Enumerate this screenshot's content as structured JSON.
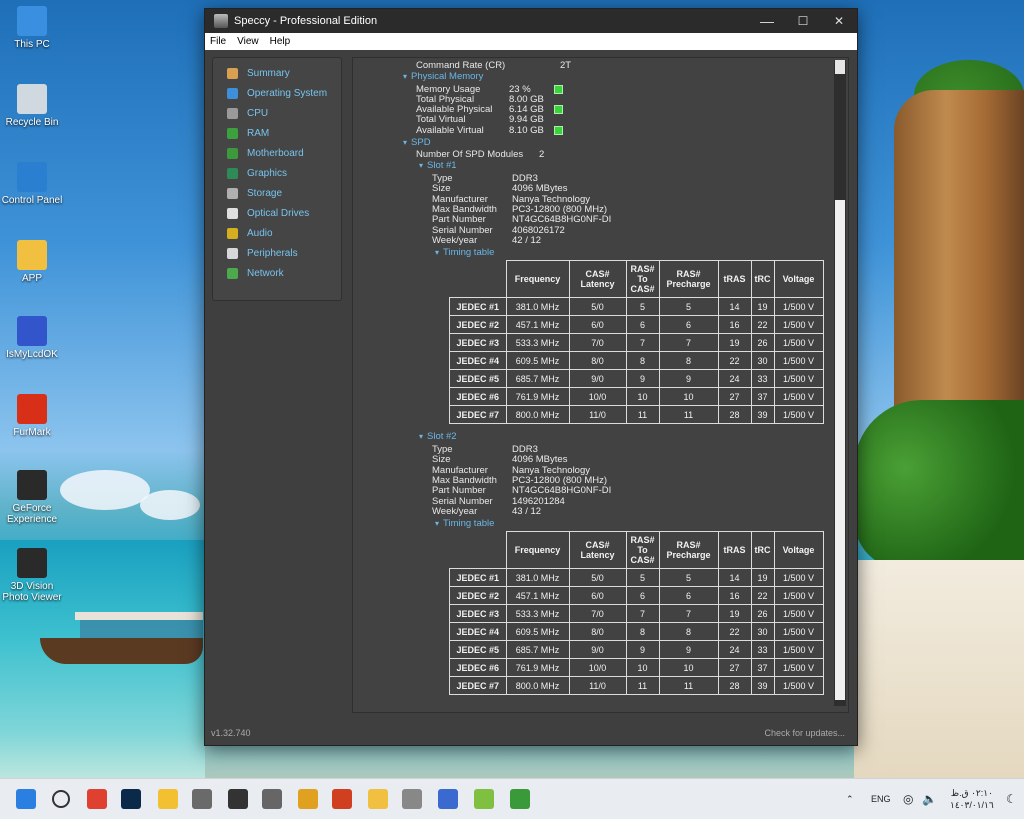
{
  "desktop": {
    "icons": [
      {
        "label": "This PC"
      },
      {
        "label": "Recycle Bin"
      },
      {
        "label": "Control Panel"
      },
      {
        "label": "APP"
      },
      {
        "label": "IsMyLcdOK"
      },
      {
        "label": "FurMark"
      },
      {
        "label": "GeForce Experience"
      },
      {
        "label": "3D Vision Photo Viewer"
      }
    ]
  },
  "window": {
    "title": "Speccy - Professional Edition",
    "menu": [
      "File",
      "View",
      "Help"
    ],
    "controls": {
      "minimize": "—",
      "maximize": "☐",
      "close": "✕"
    },
    "sidebar": [
      {
        "label": "Summary",
        "color": "#d8a050"
      },
      {
        "label": "Operating System",
        "color": "#3c8fd8"
      },
      {
        "label": "CPU",
        "color": "#9a9a9a"
      },
      {
        "label": "RAM",
        "color": "#3ca03c"
      },
      {
        "label": "Motherboard",
        "color": "#3c9a3c"
      },
      {
        "label": "Graphics",
        "color": "#2e8b57"
      },
      {
        "label": "Storage",
        "color": "#b0b0b0"
      },
      {
        "label": "Optical Drives",
        "color": "#e0e0e0"
      },
      {
        "label": "Audio",
        "color": "#d4b020"
      },
      {
        "label": "Peripherals",
        "color": "#d8d8d8"
      },
      {
        "label": "Network",
        "color": "#4caa4c"
      }
    ],
    "status": {
      "version": "v1.32.740",
      "updates": "Check for updates..."
    }
  },
  "content": {
    "command_rate": {
      "key": "Command Rate (CR)",
      "value": "2T"
    },
    "physical_memory": {
      "title": "Physical Memory",
      "rows": [
        {
          "key": "Memory Usage",
          "value": "23 %"
        },
        {
          "key": "Total Physical",
          "value": "8.00 GB"
        },
        {
          "key": "Available Physical",
          "value": "6.14 GB"
        },
        {
          "key": "Total Virtual",
          "value": "9.94 GB"
        },
        {
          "key": "Available Virtual",
          "value": "8.10 GB"
        }
      ]
    },
    "spd": {
      "title": "SPD",
      "modules_key": "Number Of SPD Modules",
      "modules_value": "2",
      "slots": [
        {
          "title": "Slot #1",
          "rows": [
            {
              "key": "Type",
              "value": "DDR3"
            },
            {
              "key": "Size",
              "value": "4096 MBytes"
            },
            {
              "key": "Manufacturer",
              "value": "Nanya Technology"
            },
            {
              "key": "Max Bandwidth",
              "value": "PC3-12800 (800 MHz)"
            },
            {
              "key": "Part Number",
              "value": "NT4GC64B8HG0NF-DI"
            },
            {
              "key": "Serial Number",
              "value": "4068026172"
            },
            {
              "key": "Week/year",
              "value": "42 / 12"
            }
          ],
          "timing_title": "Timing table"
        },
        {
          "title": "Slot #2",
          "rows": [
            {
              "key": "Type",
              "value": "DDR3"
            },
            {
              "key": "Size",
              "value": "4096 MBytes"
            },
            {
              "key": "Manufacturer",
              "value": "Nanya Technology"
            },
            {
              "key": "Max Bandwidth",
              "value": "PC3-12800 (800 MHz)"
            },
            {
              "key": "Part Number",
              "value": "NT4GC64B8HG0NF-DI"
            },
            {
              "key": "Serial Number",
              "value": "1496201284"
            },
            {
              "key": "Week/year",
              "value": "43 / 12"
            }
          ],
          "timing_title": "Timing table"
        }
      ],
      "timing_headers": [
        "Frequency",
        "CAS# Latency",
        "RAS# To CAS#",
        "RAS# Precharge",
        "tRAS",
        "tRC",
        "Voltage"
      ],
      "timing_rows": [
        [
          "JEDEC #1",
          "381.0 MHz",
          "5/0",
          "5",
          "5",
          "14",
          "19",
          "1/500 V"
        ],
        [
          "JEDEC #2",
          "457.1 MHz",
          "6/0",
          "6",
          "6",
          "16",
          "22",
          "1/500 V"
        ],
        [
          "JEDEC #3",
          "533.3 MHz",
          "7/0",
          "7",
          "7",
          "19",
          "26",
          "1/500 V"
        ],
        [
          "JEDEC #4",
          "609.5 MHz",
          "8/0",
          "8",
          "8",
          "22",
          "30",
          "1/500 V"
        ],
        [
          "JEDEC #5",
          "685.7 MHz",
          "9/0",
          "9",
          "9",
          "24",
          "33",
          "1/500 V"
        ],
        [
          "JEDEC #6",
          "761.9 MHz",
          "10/0",
          "10",
          "10",
          "27",
          "37",
          "1/500 V"
        ],
        [
          "JEDEC #7",
          "800.0 MHz",
          "11/0",
          "11",
          "11",
          "28",
          "39",
          "1/500 V"
        ]
      ]
    }
  },
  "taskbar": {
    "apps": [
      "start",
      "search",
      "chrome",
      "photoshop",
      "notes",
      "calculator",
      "store",
      "speccy",
      "paint",
      "tool",
      "files",
      "drive",
      "monitor",
      "pen",
      "money"
    ],
    "language": "ENG",
    "time": "٠٢:١٠ ق.ظ",
    "date": "١٤٠٣/٠١/١٦"
  }
}
